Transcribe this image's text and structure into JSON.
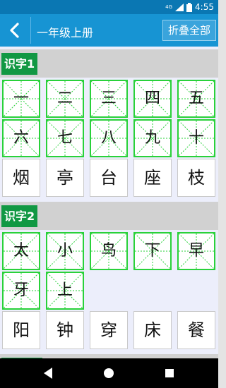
{
  "status_bar": {
    "network": "4G",
    "time": "4:55"
  },
  "app_bar": {
    "title": "一年级上册",
    "fold_all_label": "折叠全部"
  },
  "sections": [
    {
      "label": "识字1",
      "grid_chars": [
        "一",
        "二",
        "三",
        "四",
        "五",
        "六",
        "七",
        "八",
        "九",
        "十"
      ],
      "plain_chars": [
        "烟",
        "亭",
        "台",
        "座",
        "枝"
      ]
    },
    {
      "label": "识字2",
      "grid_chars": [
        "太",
        "小",
        "鸟",
        "下",
        "早",
        "牙",
        "上"
      ],
      "plain_chars": [
        "阳",
        "钟",
        "穿",
        "床",
        "餐"
      ]
    }
  ],
  "colors": {
    "status_bar": "#0a77b3",
    "app_bar": "#1794d3",
    "section_label": "#119843",
    "grid_line": "#29d13a"
  },
  "icons": {
    "back": "back-chevron-icon",
    "nav_back": "nav-back-triangle-icon",
    "nav_home": "nav-home-circle-icon",
    "nav_recents": "nav-recents-square-icon"
  }
}
